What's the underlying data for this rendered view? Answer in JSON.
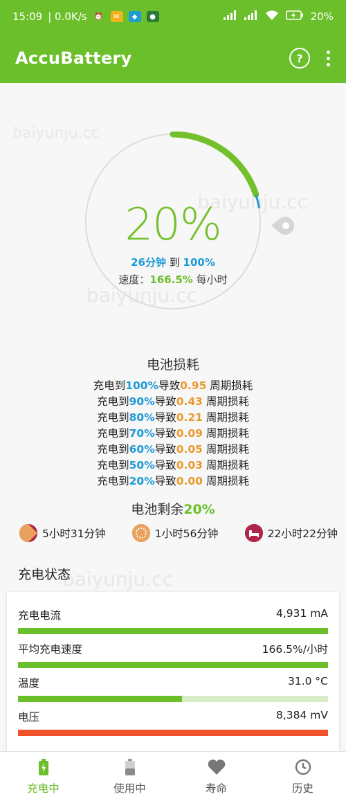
{
  "status_bar": {
    "time": "15:09",
    "speed": "| 0.0K/s",
    "battery_pct": "20"
  },
  "app": {
    "title": "AccuBattery",
    "help_label": "?"
  },
  "gauge": {
    "percent_text": "20%",
    "percent_value": 20,
    "time_to_full": "26分钟",
    "to_word": "到",
    "target": "100%",
    "speed_label": "速度：",
    "speed_value": "166.5%",
    "speed_unit": "每小时"
  },
  "wear": {
    "title": "电池损耗",
    "rows": [
      {
        "prefix": "充电到",
        "level": "100%",
        "mid": "导致",
        "value": "0.95",
        "suffix": " 周期损耗"
      },
      {
        "prefix": "充电到",
        "level": "90%",
        "mid": "导致",
        "value": "0.43",
        "suffix": " 周期损耗"
      },
      {
        "prefix": "充电到",
        "level": "80%",
        "mid": "导致",
        "value": "0.21",
        "suffix": " 周期损耗"
      },
      {
        "prefix": "充电到",
        "level": "70%",
        "mid": "导致",
        "value": "0.09",
        "suffix": " 周期损耗"
      },
      {
        "prefix": "充电到",
        "level": "60%",
        "mid": "导致",
        "value": "0.05",
        "suffix": " 周期损耗"
      },
      {
        "prefix": "充电到",
        "level": "50%",
        "mid": "导致",
        "value": "0.03",
        "suffix": " 周期损耗"
      },
      {
        "prefix": "充电到",
        "level": "20%",
        "mid": "导致",
        "value": "0.00",
        "suffix": " 周期损耗"
      }
    ]
  },
  "remaining": {
    "title_prefix": "电池剩余",
    "title_value": "20%",
    "items": [
      {
        "icon": "screen-on-pie-icon",
        "text": "5小时31分钟"
      },
      {
        "icon": "screen-off-pie-icon",
        "text": "1小时56分钟"
      },
      {
        "icon": "sleep-bed-icon",
        "text": "22小时22分钟"
      }
    ]
  },
  "charging": {
    "title": "充电状态",
    "metrics": [
      {
        "label": "充电电流",
        "value": "4,931 mA",
        "fill": 1.0,
        "color": "#6bbf2a"
      },
      {
        "label": "平均充电速度",
        "value": "166.5%/小时",
        "fill": 1.0,
        "color": "#6bbf2a"
      },
      {
        "label": "温度",
        "value": "31.0 °C",
        "fill": 0.53,
        "color": "#6bbf2a"
      },
      {
        "label": "电压",
        "value": "8,384 mV",
        "fill": 1.0,
        "color": "#f0522a"
      }
    ]
  },
  "nav": {
    "items": [
      {
        "label": "充电中",
        "icon": "battery-charging-icon",
        "active": true
      },
      {
        "label": "使用中",
        "icon": "battery-discharging-icon",
        "active": false
      },
      {
        "label": "寿命",
        "icon": "heart-icon",
        "active": false
      },
      {
        "label": "历史",
        "icon": "history-icon",
        "active": false
      }
    ]
  },
  "colors": {
    "brand": "#6bbf2a",
    "accent_blue": "#1e9ad6",
    "accent_orange": "#e99a2c",
    "warning": "#f0522a"
  },
  "watermark": "baiyunju.cc"
}
